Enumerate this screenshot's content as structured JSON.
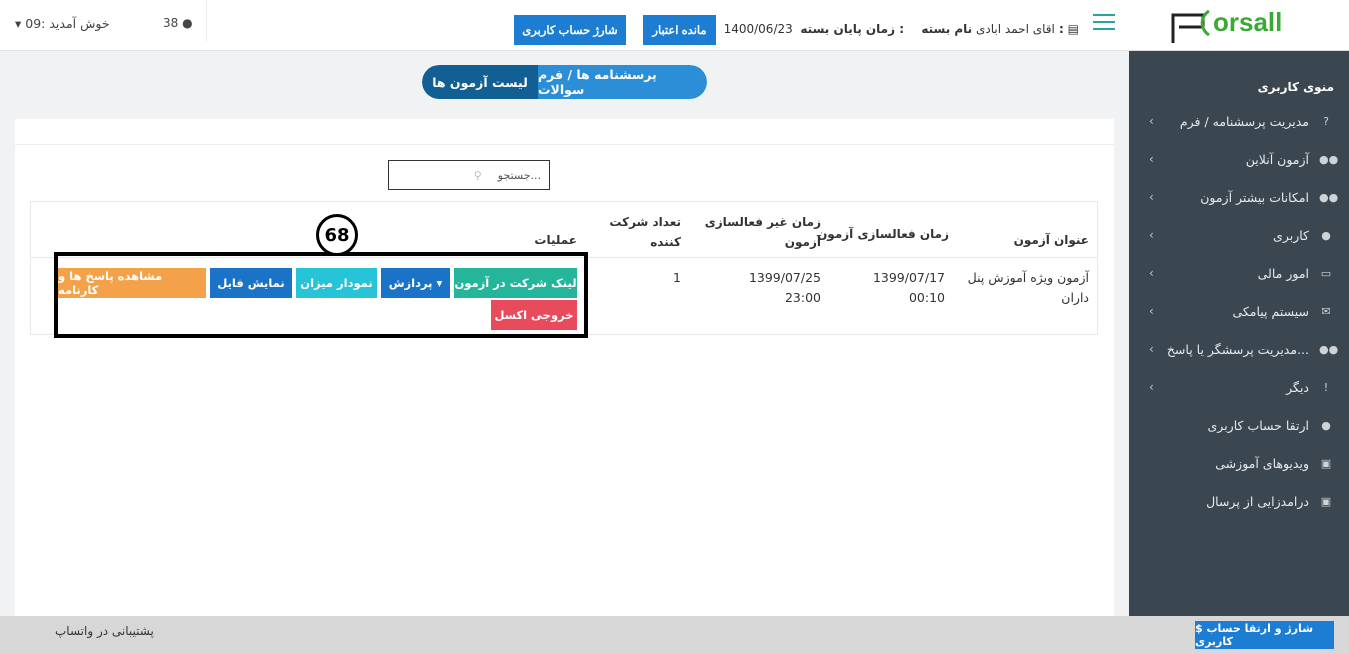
{
  "header": {
    "package_label": "نام بسته :",
    "package_value": "اقای احمد ابادی",
    "end_date_label": "زمان پایان بسته :",
    "end_date_value": "1400/06/23",
    "balance_button": "مانده اعتبار",
    "charge_button": "شارژ حساب کاربری",
    "user_count": "38",
    "welcome": "09: خوش آمدید"
  },
  "tabs": {
    "active": "لیست آزمون ها",
    "other": "پرسشنامه ها / فرم سوالات"
  },
  "search": {
    "placeholder": "جستجو..."
  },
  "table": {
    "headers": {
      "title": "عنوان آزمون",
      "activation": "زمان فعالسازی آزمون",
      "deactivation": "زمان غیر فعالسازی آزمون",
      "participants": "تعداد شرکت کننده",
      "operations": "عملیات"
    },
    "rows": [
      {
        "title": "آزمون ویژه آموزش پنل داران",
        "activation": "1399/07/17 00:10",
        "deactivation": "1399/07/25 23:00",
        "participants": "1"
      }
    ],
    "operations": {
      "link": "لینک شرکت در آزمون",
      "process": "پردازش",
      "chart": "نمودار میزان",
      "file": "نمایش فایل",
      "view": "مشاهده پاسخ ها و کارنامه",
      "excel": "خروجی اکسل"
    }
  },
  "annotation": {
    "badge": "68"
  },
  "sidebar": {
    "logo": "porsall",
    "menu_title": "منوی کاربری",
    "items": [
      {
        "label": "مدیریت پرسشنامه / فرم",
        "icon": "?"
      },
      {
        "label": "آزمون آنلاین",
        "icon": "👥"
      },
      {
        "label": "امکانات بیشتر آزمون",
        "icon": "👥"
      },
      {
        "label": "کاربری",
        "icon": "👤"
      },
      {
        "label": "امور مالی",
        "icon": "💵"
      },
      {
        "label": "سیستم پیامکی",
        "icon": "✉"
      },
      {
        "label": "مدیریت پرسشگر یا پاسخ...",
        "icon": "👥"
      },
      {
        "label": "دیگر",
        "icon": "!"
      },
      {
        "label": "ارتقا حساب کاربری",
        "icon": "👤"
      },
      {
        "label": "ویدیوهای آموزشی",
        "icon": "▣"
      },
      {
        "label": "درامدزایی از پرسال",
        "icon": "🎁"
      }
    ]
  },
  "footer": {
    "whatsapp": "پشتیبانی در واتساپ",
    "charge_upgrade": "$ شارژ و ارتقا حساب کاربری"
  },
  "colors": {
    "sidebar_bg": "#3a4750",
    "primary": "#1c7dd2",
    "teal": "#25b59a",
    "orange": "#f4a24a",
    "red": "#e84b5c"
  }
}
